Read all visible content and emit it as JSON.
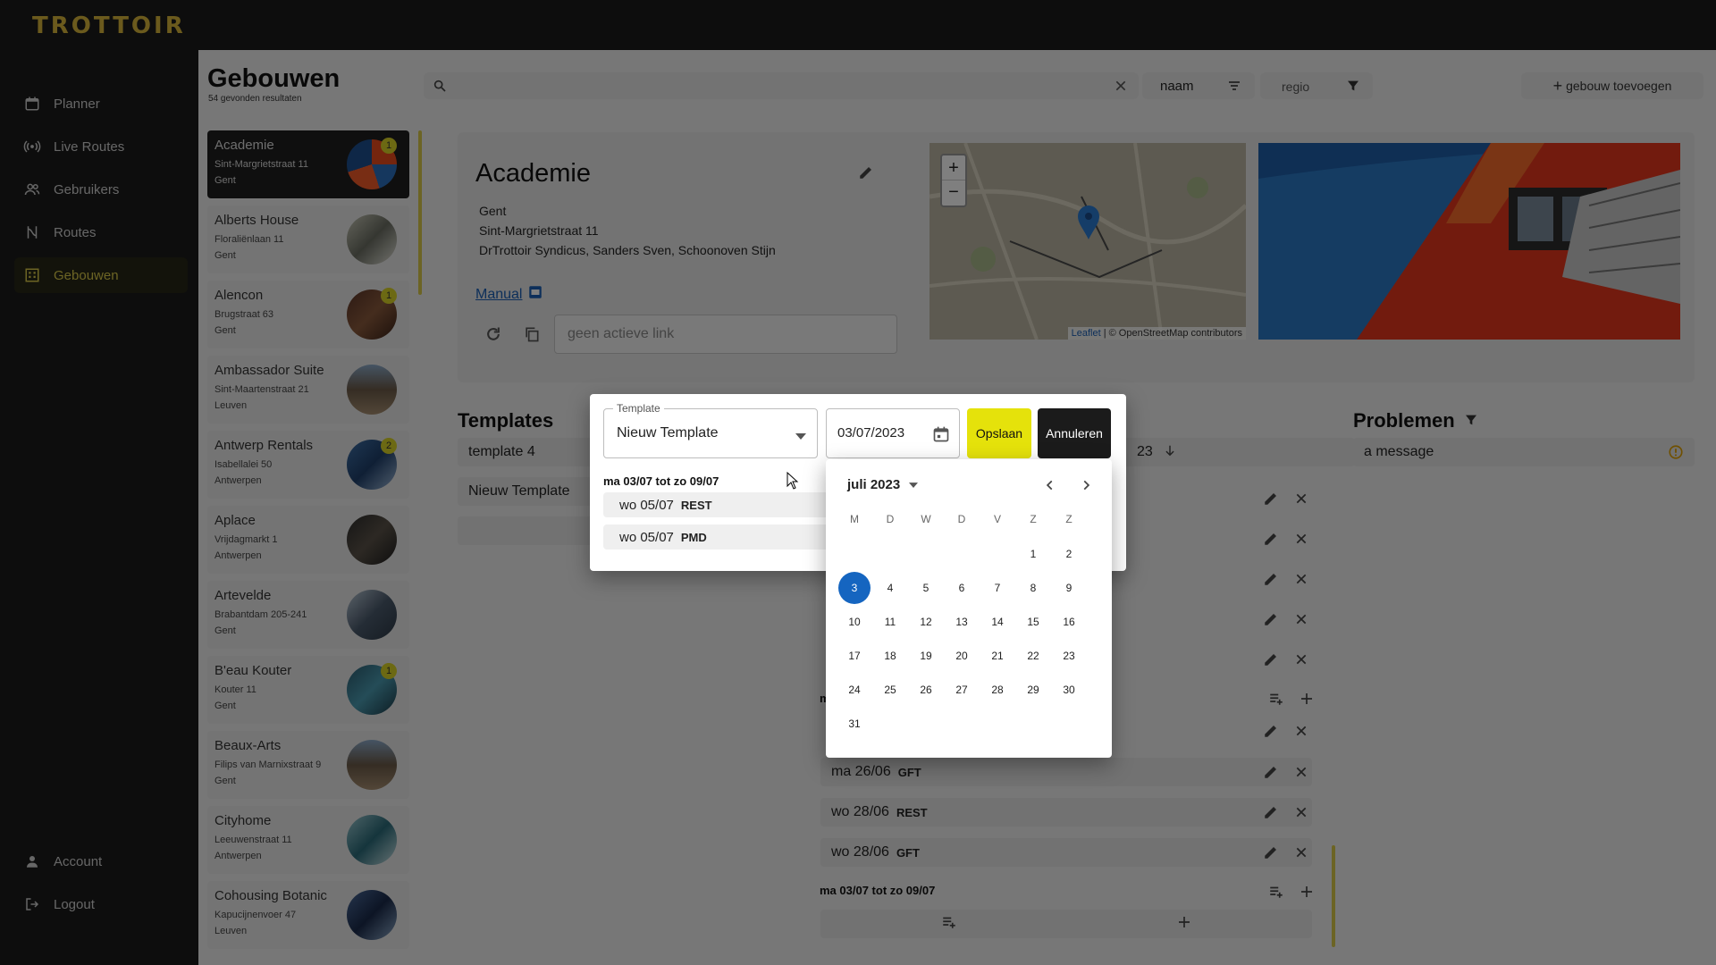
{
  "app": {
    "logo": "TROTTOIR"
  },
  "nav": {
    "items": [
      {
        "label": "Planner",
        "icon": "calendar-icon"
      },
      {
        "label": "Live Routes",
        "icon": "broadcast-icon"
      },
      {
        "label": "Gebruikers",
        "icon": "users-icon"
      },
      {
        "label": "Routes",
        "icon": "route-icon"
      },
      {
        "label": "Gebouwen",
        "icon": "building-icon"
      }
    ],
    "bottom": [
      {
        "label": "Account",
        "icon": "person-icon"
      },
      {
        "label": "Logout",
        "icon": "logout-icon"
      }
    ]
  },
  "page": {
    "title": "Gebouwen",
    "result_count": "54 gevonden resultaten"
  },
  "toolbar": {
    "search_placeholder": "",
    "sort_label": "naam",
    "filter_label": "regio",
    "add_label": "gebouw toevoegen"
  },
  "buildings": [
    {
      "name": "Academie",
      "address": "Sint-Margrietstraat 11",
      "city": "Gent",
      "badge": "1"
    },
    {
      "name": "Alberts House",
      "address": "Floraliënlaan 11",
      "city": "Gent",
      "badge": ""
    },
    {
      "name": "Alencon",
      "address": "Brugstraat 63",
      "city": "Gent",
      "badge": "1"
    },
    {
      "name": "Ambassador Suite",
      "address": "Sint-Maartenstraat 21",
      "city": "Leuven",
      "badge": ""
    },
    {
      "name": "Antwerp Rentals",
      "address": "Isabellalei 50",
      "city": "Antwerpen",
      "badge": "2"
    },
    {
      "name": "Aplace",
      "address": "Vrijdagmarkt 1",
      "city": "Antwerpen",
      "badge": ""
    },
    {
      "name": "Artevelde",
      "address": "Brabantdam 205-241",
      "city": "Gent",
      "badge": ""
    },
    {
      "name": "B'eau Kouter",
      "address": "Kouter 11",
      "city": "Gent",
      "badge": "1"
    },
    {
      "name": "Beaux-Arts",
      "address": "Filips van Marnixstraat 9",
      "city": "Gent",
      "badge": ""
    },
    {
      "name": "Cityhome",
      "address": "Leeuwenstraat 11",
      "city": "Antwerpen",
      "badge": ""
    },
    {
      "name": "Cohousing Botanic",
      "address": "Kapucijnenvoer 47",
      "city": "Leuven",
      "badge": ""
    }
  ],
  "detail": {
    "title": "Academie",
    "city": "Gent",
    "address": "Sint-Margrietstraat 11",
    "syndicus": "DrTrottoir Syndicus, Sanders Sven, Schoonoven Stijn",
    "manual_label": "Manual",
    "link_placeholder": "geen actieve link",
    "map_attribution_leaflet": "Leaflet",
    "map_attribution_rest": "| © OpenStreetMap contributors"
  },
  "templates": {
    "title": "Templates",
    "items": [
      "template 4",
      "Nieuw Template"
    ]
  },
  "schedule": {
    "partial_date": "23",
    "partial_week": "m",
    "rows": [
      {
        "date": "ma 26/06",
        "type": "GFT"
      },
      {
        "date": "wo 28/06",
        "type": "REST"
      },
      {
        "date": "wo 28/06",
        "type": "GFT"
      }
    ],
    "week_label": "ma 03/07 tot zo 09/07"
  },
  "problems": {
    "title": "Problemen",
    "items": [
      "a message"
    ]
  },
  "dialog": {
    "template_label": "Template",
    "template_value": "Nieuw Template",
    "date_value": "03/07/2023",
    "save_label": "Opslaan",
    "cancel_label": "Annuleren",
    "week_label": "ma 03/07 tot zo 09/07",
    "entries": [
      {
        "date": "wo 05/07",
        "type": "REST"
      },
      {
        "date": "wo 05/07",
        "type": "PMD"
      }
    ]
  },
  "calendar": {
    "month_label": "juli 2023",
    "weekdays": [
      "M",
      "D",
      "W",
      "D",
      "V",
      "Z",
      "Z"
    ],
    "first_weekday_index": 5,
    "days_in_month": 31,
    "selected_day": 3
  },
  "colors": {
    "accent": "#e5e20b",
    "selected": "#1565c0",
    "link": "#1a5fb4"
  }
}
